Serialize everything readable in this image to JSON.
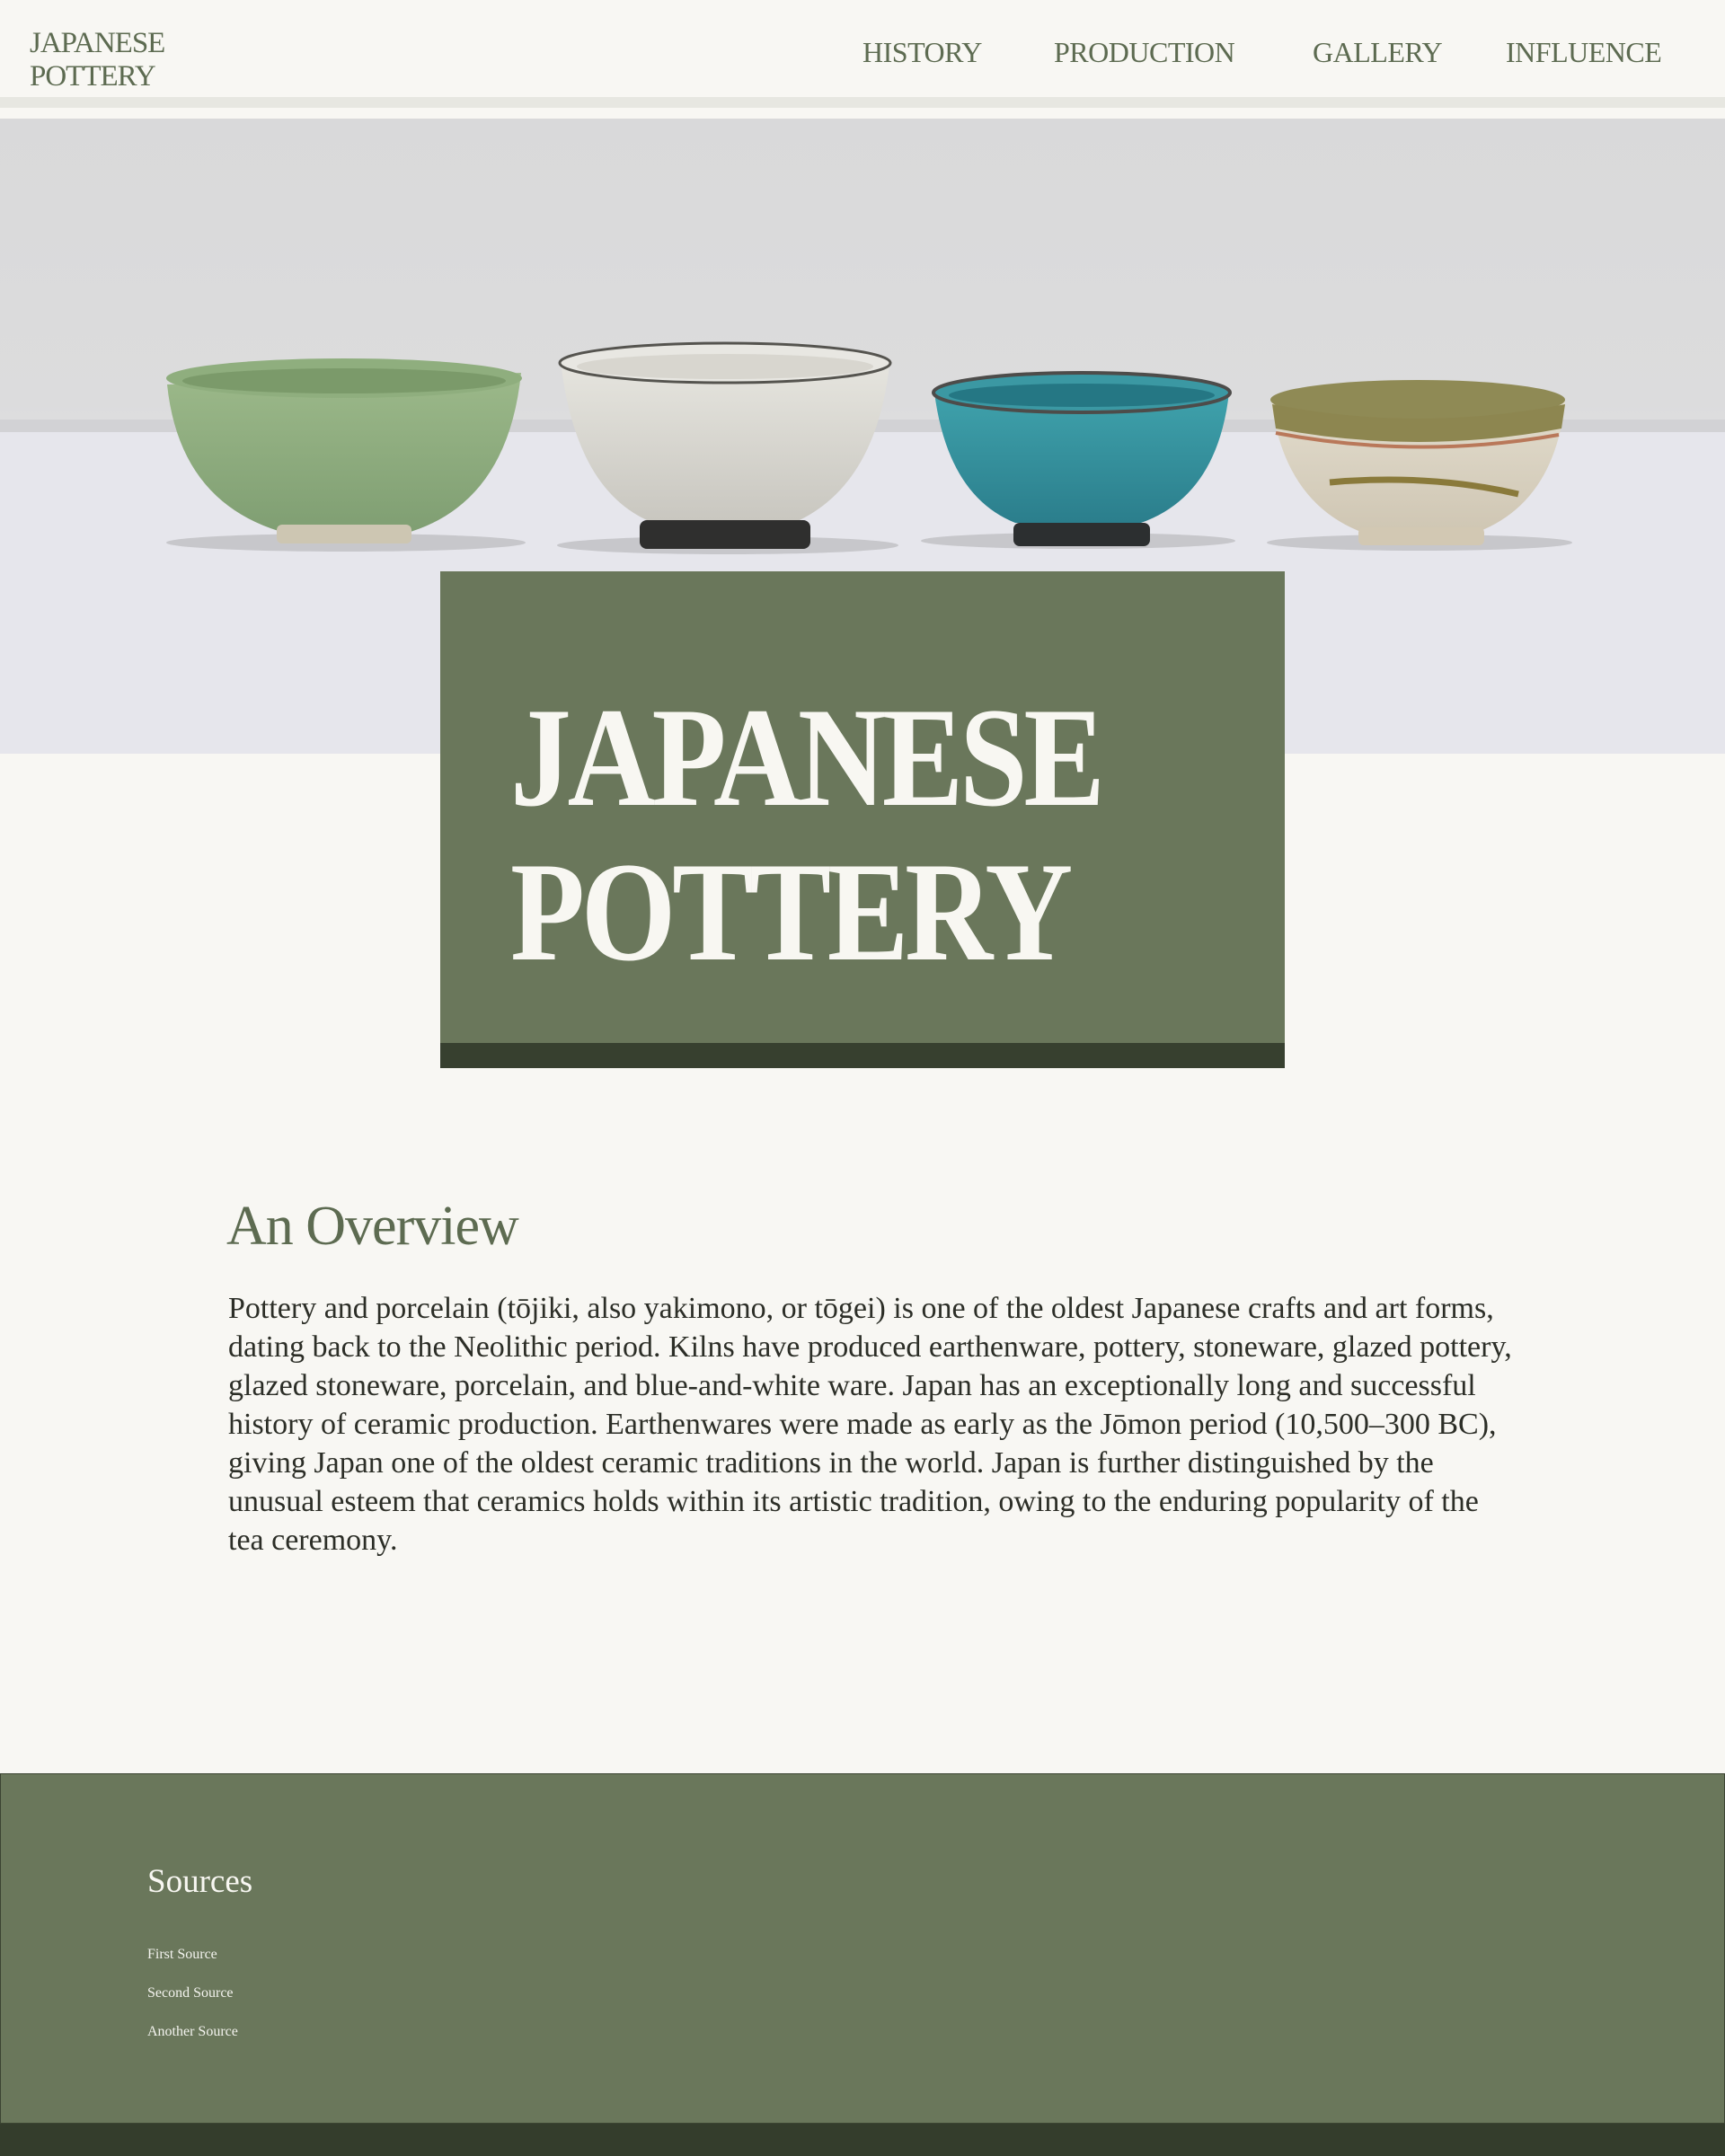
{
  "header": {
    "logo_line1": "JAPANESE",
    "logo_line2": "POTTERY",
    "nav": [
      {
        "label": "HISTORY"
      },
      {
        "label": "PRODUCTION"
      },
      {
        "label": "GALLERY"
      },
      {
        "label": "INFLUENCE"
      }
    ]
  },
  "hero": {
    "title_line1": "JAPANESE",
    "title_line2": "POTTERY"
  },
  "overview": {
    "heading": "An Overview",
    "body": "Pottery and porcelain (tōjiki, also yakimono, or tōgei) is one of the oldest Japanese crafts and art forms, dating back to the Neolithic period. Kilns have produced earthenware, pottery, stoneware, glazed pottery, glazed stoneware, porcelain, and blue-and-white ware. Japan has an exceptionally long and successful history of ceramic production. Earthenwares were made as early as the Jōmon period (10,500–300 BC), giving Japan one of the oldest ceramic traditions in the world. Japan is further distinguished by the unusual esteem that ceramics holds within its artistic tradition, owing to the enduring popularity of the tea ceremony."
  },
  "footer": {
    "heading": "Sources",
    "links": [
      {
        "label": "First Source"
      },
      {
        "label": "Second Source"
      },
      {
        "label": "Another Source"
      }
    ]
  },
  "colors": {
    "accent_green": "#6a775b",
    "dark_green": "#37402f",
    "background": "#f8f7f3"
  }
}
